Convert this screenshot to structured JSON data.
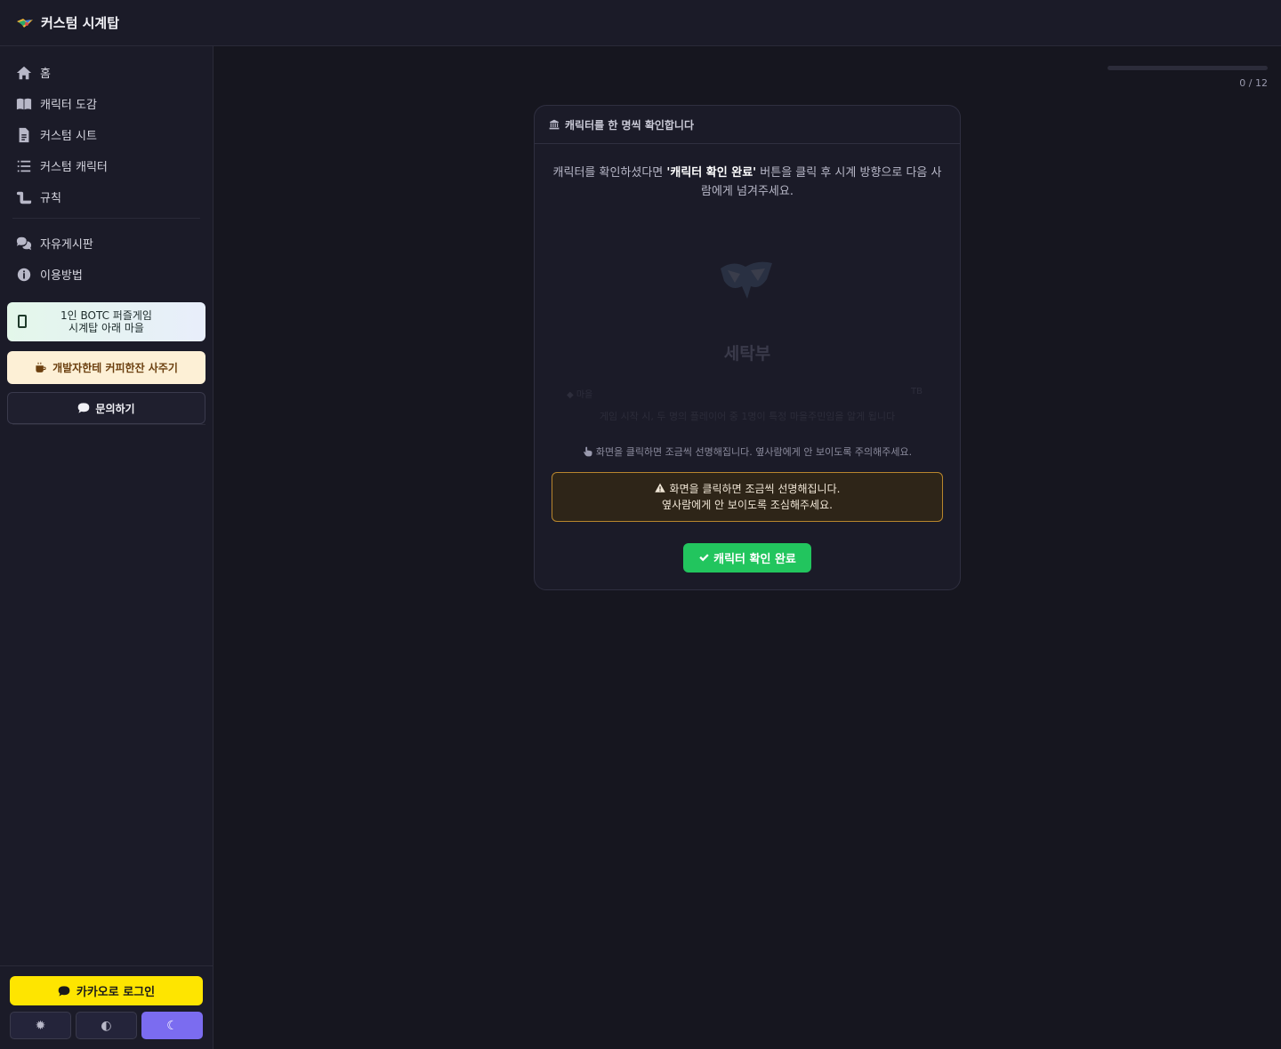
{
  "app": {
    "title": "커스텀 시계탑"
  },
  "sidebar": {
    "items": [
      {
        "label": "홈",
        "icon": "home-icon"
      },
      {
        "label": "캐릭터 도감",
        "icon": "book-icon"
      },
      {
        "label": "커스텀 시트",
        "icon": "document-icon"
      },
      {
        "label": "커스텀 캐릭터",
        "icon": "list-icon"
      },
      {
        "label": "규칙",
        "icon": "scroll-icon"
      },
      {
        "label": "자유게시판",
        "icon": "comments-icon"
      },
      {
        "label": "이용방법",
        "icon": "info-icon"
      }
    ],
    "promo_game_line1": "1인 BOTC 퍼즐게임",
    "promo_game_line2": "시계탑 아래 마을",
    "promo_coffee": "개발자한테 커피한잔 사주기",
    "promo_inquiry": "문의하기",
    "kakao_login": "카카오로 로그인",
    "theme_options": [
      "light",
      "system",
      "dark"
    ],
    "theme_selected": "dark"
  },
  "progress": {
    "label": "0 / 12",
    "value": 0,
    "total": 12
  },
  "card": {
    "header": "캐릭터를 한 명씩 확인합니다",
    "instruction_pre": "캐릭터를 확인하셨다면 ",
    "instruction_bold": "'캐릭터 확인 완료'",
    "instruction_post": " 버튼을 클릭 후 시계 방향으로 다음 사람에게 넘겨주세요.",
    "character_name": "세탁부",
    "hint": "화면을 클릭하면 조금씩 선명해집니다. 옆사람에게 안 보이도록 주의해주세요.",
    "warning_line1": "화면을 클릭하면 조금씩 선명해집니다.",
    "warning_line2": "옆사람에게 안 보이도록 조심해주세요.",
    "confirm_button": "캐릭터 확인 완료"
  },
  "colors": {
    "accent": "#7b6cf0",
    "confirm": "#22c55e",
    "kakao": "#fee500",
    "warning_border": "#b8862d"
  }
}
